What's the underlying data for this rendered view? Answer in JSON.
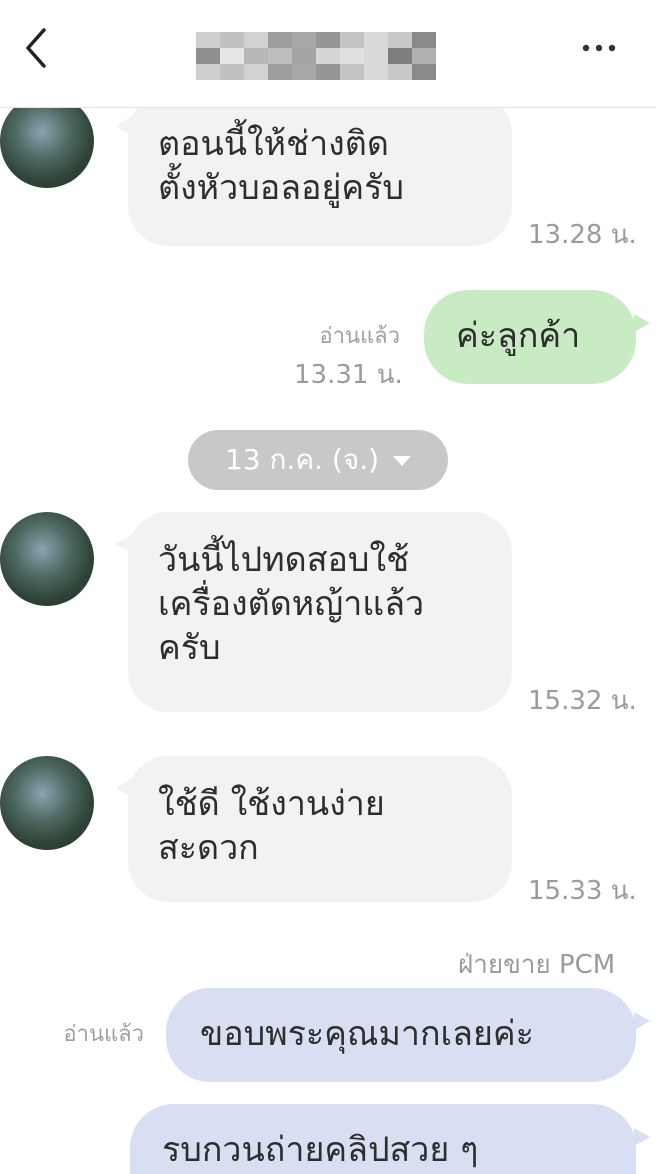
{
  "header": {
    "back_icon": "chevron-left-icon",
    "more_icon": "more-horizontal-icon",
    "title_blur_colors": [
      "#cfcfcf",
      "#9e9e9e",
      "#c4c4c4",
      "#8a8a8a",
      "#b8b8b8",
      "#d6d6d6",
      "#7d7d7d",
      "#c0c0c0",
      "#a8a8a8",
      "#dadada",
      "#8f8f8f",
      "#bdbdbd",
      "#e0e0e0",
      "#b0b0b0",
      "#d2d2d2",
      "#969696",
      "#c8c8c8",
      "#e6e6e6",
      "#a4a4a4",
      "#d9d9d9"
    ]
  },
  "messages": [
    {
      "text": "ตอนนี้ให้ช่างติด\nตั้งหัวบอลอยู่ครับ",
      "time": "13.28 น."
    },
    {
      "text": "ค่ะลูกค้า",
      "read": "อ่านแล้ว",
      "time": "13.31 น."
    },
    {
      "date_divider": "13 ก.ค. (จ.)"
    },
    {
      "text": "วันนี้ไปทดสอบใช้\nเครื่องตัดหญ้าแล้ว\nครับ",
      "time": "15.32 น."
    },
    {
      "text": "ใช้ดี ใช้งานง่าย\nสะดวก",
      "time": "15.33 น."
    },
    {
      "sender": "ฝ่ายขาย PCM",
      "text": "ขอบพระคุณมากเลยค่ะ",
      "read": "อ่านแล้ว"
    },
    {
      "text": "รบกวนถ่ายคลิปสวย ๆ"
    }
  ],
  "colors": {
    "incoming_bubble": "#f1f2f4",
    "outgoing_green": "#c9ebc3",
    "outgoing_purple": "#d9dff3",
    "date_pill": "#c8c8c8"
  }
}
